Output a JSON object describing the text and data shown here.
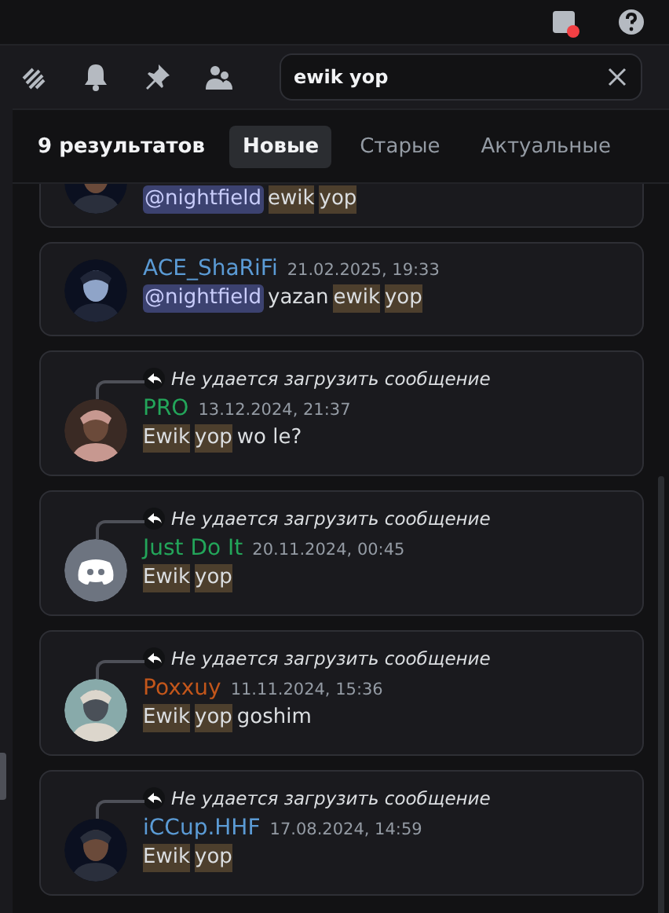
{
  "search": {
    "value": "ewik yop"
  },
  "results": {
    "count": "9 результатов",
    "tabs": [
      {
        "label": "Новые",
        "selected": true
      },
      {
        "label": "Старые",
        "selected": false
      },
      {
        "label": "Актуальные",
        "selected": false
      }
    ]
  },
  "messages": [
    {
      "partial": true,
      "avatar": {
        "kind": "picture"
      },
      "parts": [
        {
          "text": "@nightfield",
          "kind": "mention"
        },
        {
          "text": "ewik",
          "kind": "highlight"
        },
        {
          "text": "yop",
          "kind": "highlight"
        }
      ]
    },
    {
      "author": "ACE_ShaRiFi",
      "color": "#5b9bd5",
      "time": "21.02.2025, 19:33",
      "avatar": {
        "kind": "picture"
      },
      "parts": [
        {
          "text": "@nightfield",
          "kind": "mention"
        },
        {
          "text": "yazan",
          "kind": "plain"
        },
        {
          "text": "ewik",
          "kind": "highlight"
        },
        {
          "text": "yop",
          "kind": "highlight"
        }
      ]
    },
    {
      "reply": "Не удается загрузить сообщение",
      "author": "PRO",
      "color": "#23a55a",
      "time": "13.12.2024, 21:37",
      "avatar": {
        "kind": "picture"
      },
      "parts": [
        {
          "text": "Ewik",
          "kind": "highlight"
        },
        {
          "text": "yop",
          "kind": "highlight"
        },
        {
          "text": "wo le?",
          "kind": "plain"
        }
      ]
    },
    {
      "reply": "Не удается загрузить сообщение",
      "author": "Just Do It",
      "color": "#23a55a",
      "time": "20.11.2024, 00:45",
      "avatar": {
        "kind": "default"
      },
      "parts": [
        {
          "text": "Ewik",
          "kind": "highlight"
        },
        {
          "text": "yop",
          "kind": "highlight"
        }
      ]
    },
    {
      "reply": "Не удается загрузить сообщение",
      "author": "Poxxuy",
      "color": "#c2561b",
      "time": "11.11.2024, 15:36",
      "avatar": {
        "kind": "picture"
      },
      "parts": [
        {
          "text": "Ewik",
          "kind": "highlight"
        },
        {
          "text": "yop",
          "kind": "highlight"
        },
        {
          "text": "goshim",
          "kind": "plain"
        }
      ]
    },
    {
      "reply": "Не удается загрузить сообщение",
      "author": "iCCup.HHF",
      "color": "#5b9bd5",
      "time": "17.08.2024, 14:59",
      "avatar": {
        "kind": "picture"
      },
      "parts": [
        {
          "text": "Ewik",
          "kind": "highlight"
        },
        {
          "text": "yop",
          "kind": "highlight"
        }
      ]
    }
  ]
}
